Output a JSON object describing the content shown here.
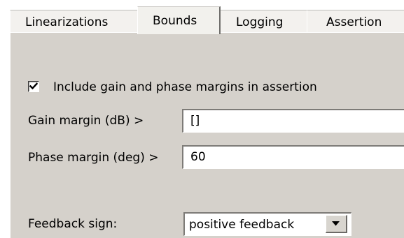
{
  "tabs": [
    {
      "label": "Linearizations",
      "active": false
    },
    {
      "label": "Bounds",
      "active": true
    },
    {
      "label": "Logging",
      "active": false
    },
    {
      "label": "Assertion",
      "active": false
    }
  ],
  "bounds": {
    "include_margins_checkbox": {
      "label": "Include gain and phase margins in assertion",
      "checked": true
    },
    "gain_margin": {
      "label": "Gain margin (dB) >",
      "value": "[]"
    },
    "phase_margin": {
      "label": "Phase margin (deg) >",
      "value": "60"
    },
    "feedback_sign": {
      "label": "Feedback sign:",
      "selected": "positive feedback"
    }
  },
  "icons": {
    "checkmark": "checkmark-icon",
    "dropdown_arrow": "chevron-down-icon"
  },
  "colors": {
    "panel_background": "#d5d1cb",
    "tab_background": "#f3f1ee",
    "field_background": "#ffffff"
  }
}
